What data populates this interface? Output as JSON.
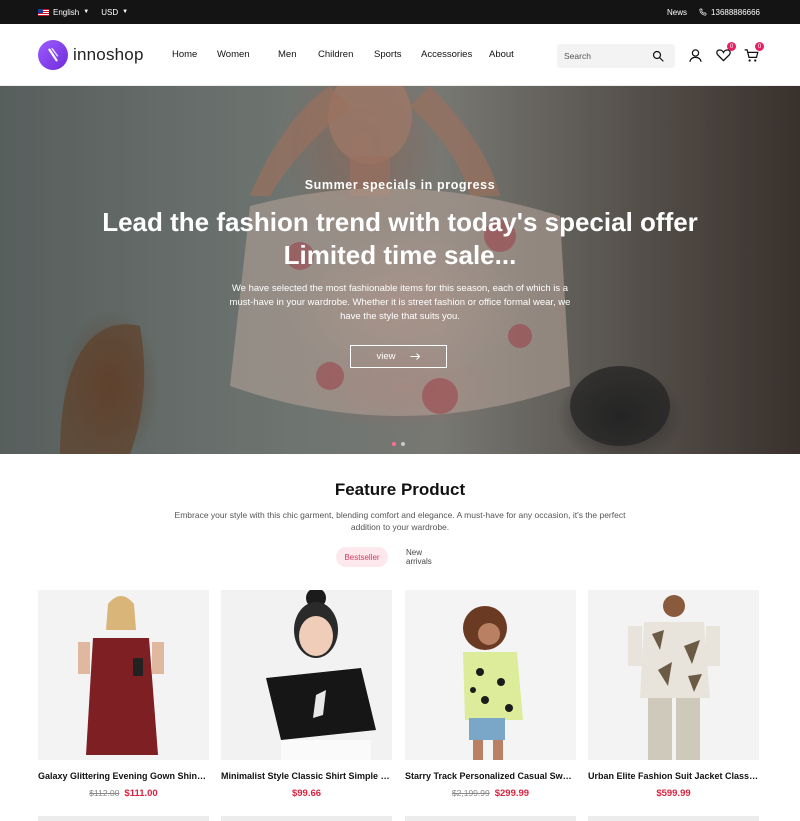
{
  "topbar": {
    "language": "English",
    "currency": "USD",
    "news": "News",
    "phone": "13688886666"
  },
  "header": {
    "logo_text": "innoshop",
    "nav": [
      "Home",
      "Women",
      "Men",
      "Children",
      "Sports",
      "Accessories",
      "About"
    ],
    "search_placeholder": "Search",
    "wishlist_count": "0",
    "cart_count": "0"
  },
  "hero": {
    "subtitle": "Summer specials in progress",
    "title_line1": "Lead the fashion trend with today's special offer",
    "title_line2": "Limited time sale...",
    "description": "We have selected the most fashionable items for this season, each of which is a must-have in your wardrobe. Whether it is street fashion or office formal wear, we have the style that suits you.",
    "button_label": "view"
  },
  "feature": {
    "title": "Feature Product",
    "description": "Embrace your style with this chic garment, blending comfort and elegance. A must-have for any occasion, it's the perfect addition to your wardrobe.",
    "tabs": [
      "Bestseller",
      "New arrivals"
    ]
  },
  "products": [
    {
      "name": "Galaxy Glittering Evening Gown Shines ...",
      "old_price": "$112.00",
      "price": "$111.00"
    },
    {
      "name": "Minimalist Style Classic Shirt Simple but ...",
      "old_price": "",
      "price": "$99.66"
    },
    {
      "name": "Starry Track Personalized Casual Sweater...",
      "old_price": "$2,199.99",
      "price": "$299.99"
    },
    {
      "name": "Urban Elite Fashion Suit Jacket Classic Cut",
      "old_price": "",
      "price": "$599.99"
    }
  ],
  "colors": {
    "topbar_bg": "#141414",
    "accent_pink": "#e61e63",
    "price_red": "#d8233f",
    "logo_purple": "#7b3bea"
  }
}
